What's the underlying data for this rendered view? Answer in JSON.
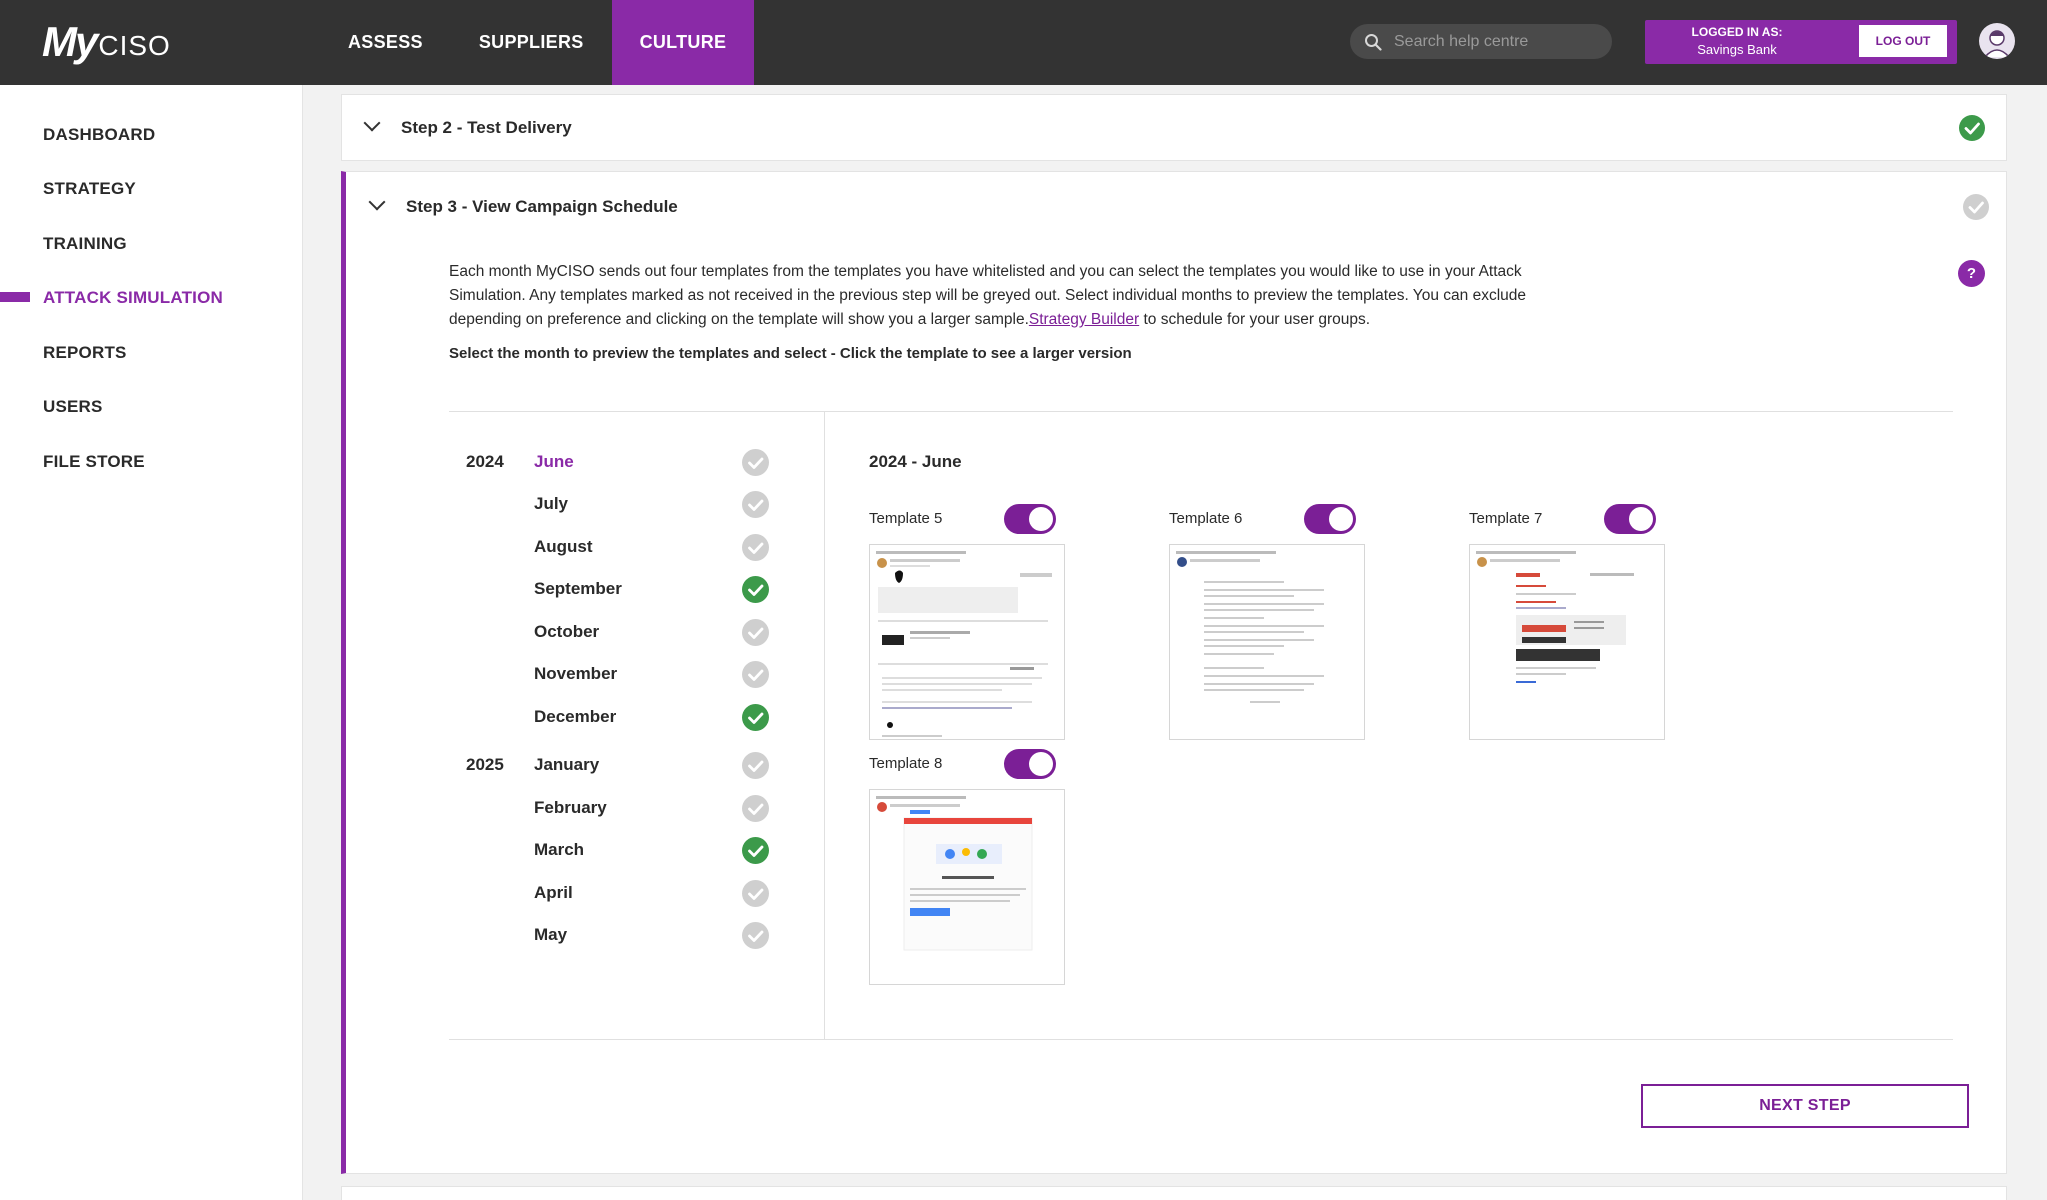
{
  "brand": {
    "logo_my": "My",
    "logo_ciso": "CISO",
    "accent": "#8a2aa7"
  },
  "nav": {
    "tabs": [
      {
        "label": "ASSESS"
      },
      {
        "label": "SUPPLIERS"
      },
      {
        "label": "CULTURE"
      }
    ]
  },
  "search": {
    "placeholder": "Search help centre"
  },
  "account": {
    "logged_in_label": "LOGGED IN AS:",
    "organisation": "Savings Bank",
    "logout_label": "LOG OUT"
  },
  "sidebar": {
    "items": [
      {
        "label": "DASHBOARD"
      },
      {
        "label": "STRATEGY"
      },
      {
        "label": "TRAINING"
      },
      {
        "label": "ATTACK SIMULATION"
      },
      {
        "label": "REPORTS"
      },
      {
        "label": "USERS"
      },
      {
        "label": "FILE STORE"
      }
    ]
  },
  "step2": {
    "title": "Step 2 - Test Delivery",
    "status": "complete"
  },
  "step3": {
    "title": "Step 3 - View Campaign Schedule",
    "status": "incomplete",
    "description_part1": "Each month MyCISO sends out four templates from the templates you have whitelisted and you can select the templates you would like to use in your Attack Simulation. Any templates marked as not received in the previous step will be greyed out. Select individual months to preview the templates. You can exclude depending on preference and clicking on the template will show you a larger sample.",
    "description_link": "Strategy Builder",
    "description_part2": " to schedule for your user groups.",
    "instruction": "Select the month to preview the templates and select - Click the template to see a larger version",
    "help_label": "?",
    "years": [
      {
        "label": "2024"
      },
      {
        "label": "2025"
      }
    ],
    "months": [
      {
        "label": "June",
        "scheduled": false
      },
      {
        "label": "July",
        "scheduled": false
      },
      {
        "label": "August",
        "scheduled": false
      },
      {
        "label": "September",
        "scheduled": true
      },
      {
        "label": "October",
        "scheduled": false
      },
      {
        "label": "November",
        "scheduled": false
      },
      {
        "label": "December",
        "scheduled": true
      },
      {
        "label": "January",
        "scheduled": false
      },
      {
        "label": "February",
        "scheduled": false
      },
      {
        "label": "March",
        "scheduled": true
      },
      {
        "label": "April",
        "scheduled": false
      },
      {
        "label": "May",
        "scheduled": false
      }
    ],
    "selected_month_title": "2024 - June",
    "templates": [
      {
        "label": "Template 5",
        "enabled": true
      },
      {
        "label": "Template 6",
        "enabled": true
      },
      {
        "label": "Template 7",
        "enabled": true
      },
      {
        "label": "Template 8",
        "enabled": true
      }
    ],
    "next_label": "NEXT STEP"
  }
}
